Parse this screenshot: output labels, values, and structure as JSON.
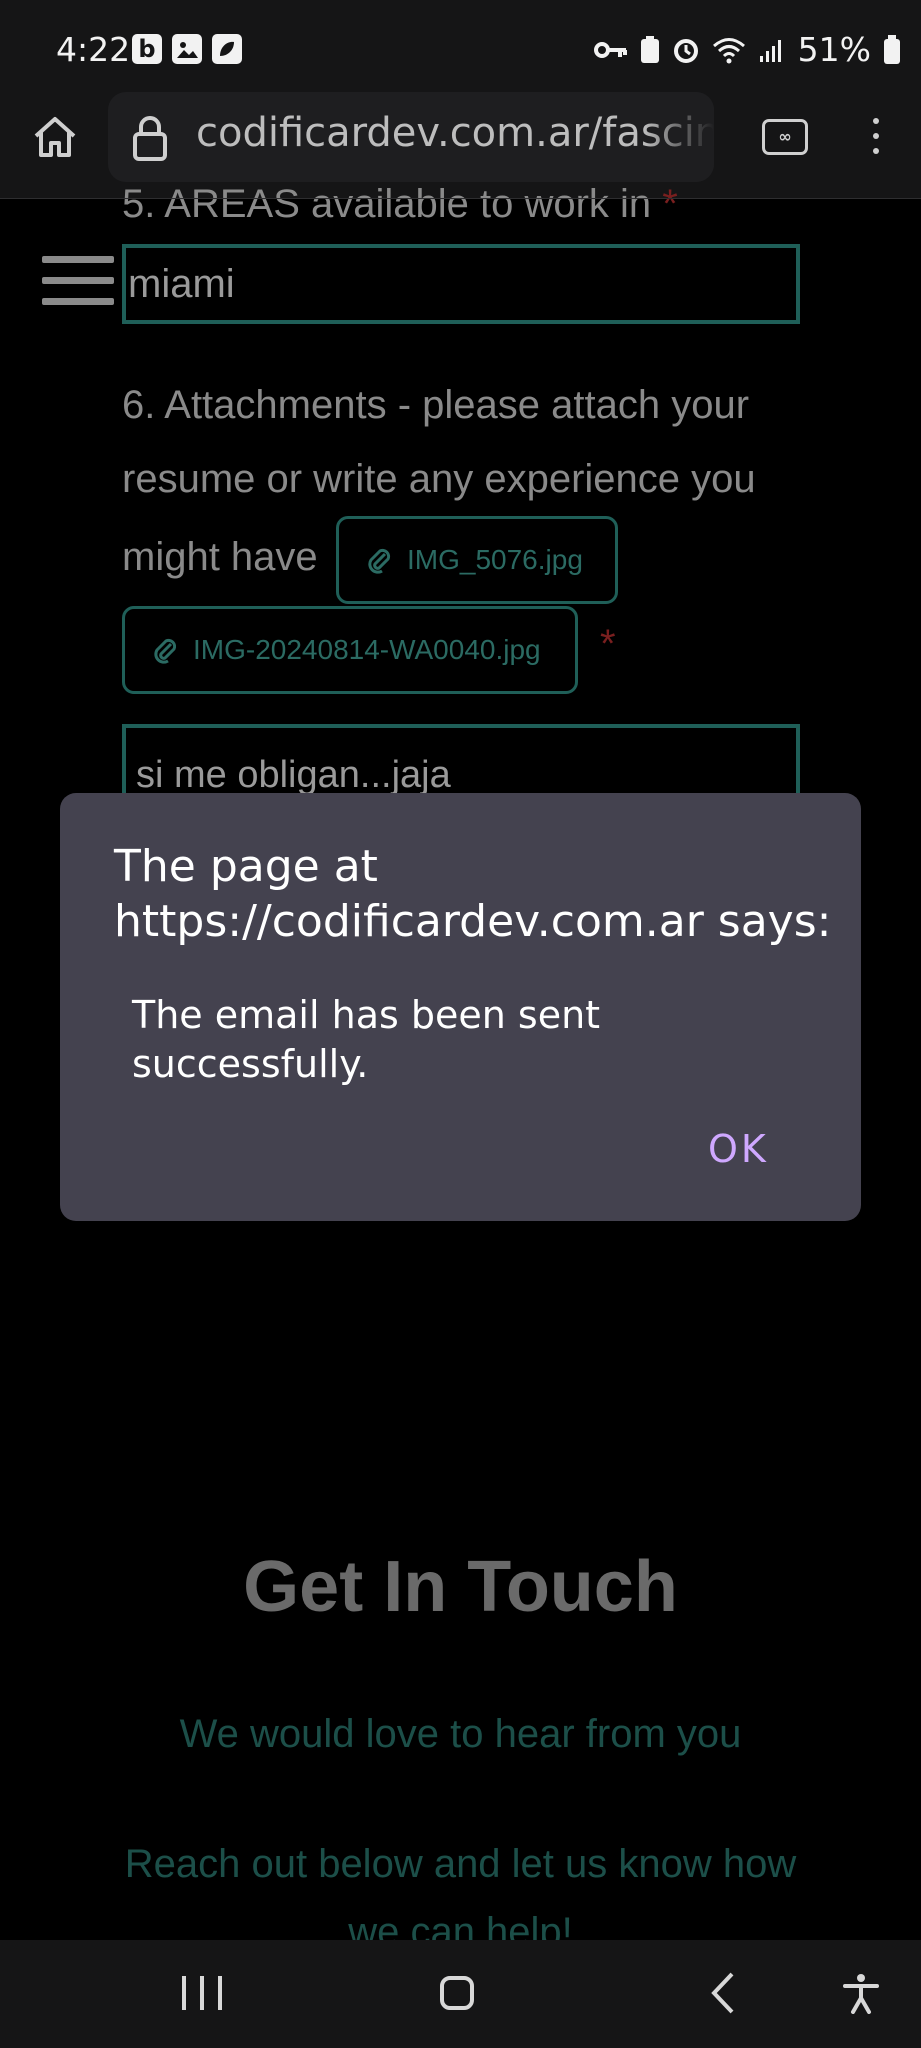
{
  "status_bar": {
    "time": "4:22",
    "left_icons": [
      "b",
      "image-icon",
      "leaf-icon"
    ],
    "battery_percent": "51%"
  },
  "browser": {
    "url": "codificardev.com.ar/fascina",
    "tabs_label": "∞"
  },
  "form": {
    "areas_label": "5. AREAS available to work in",
    "areas_required": "*",
    "areas_value": "miami",
    "attachments_line1": "6. Attachments - please attach your",
    "attachments_line2": "resume or write any experience you",
    "attachments_line3": "might have",
    "attachments": [
      {
        "name": "IMG_5076.jpg"
      },
      {
        "name": "IMG-20240814-WA0040.jpg"
      }
    ],
    "attachments_required": "*",
    "experience_value": "si me obligan...jaja"
  },
  "contact": {
    "title": "Get In Touch",
    "subtitle": "We would love to hear from you",
    "body_line1": "Reach out below and let us know how",
    "body_line2": "we can help!"
  },
  "dialog": {
    "title": "The page at https://codificardev.com.ar says:",
    "message": "The email has been sent successfully.",
    "ok_label": "OK"
  }
}
